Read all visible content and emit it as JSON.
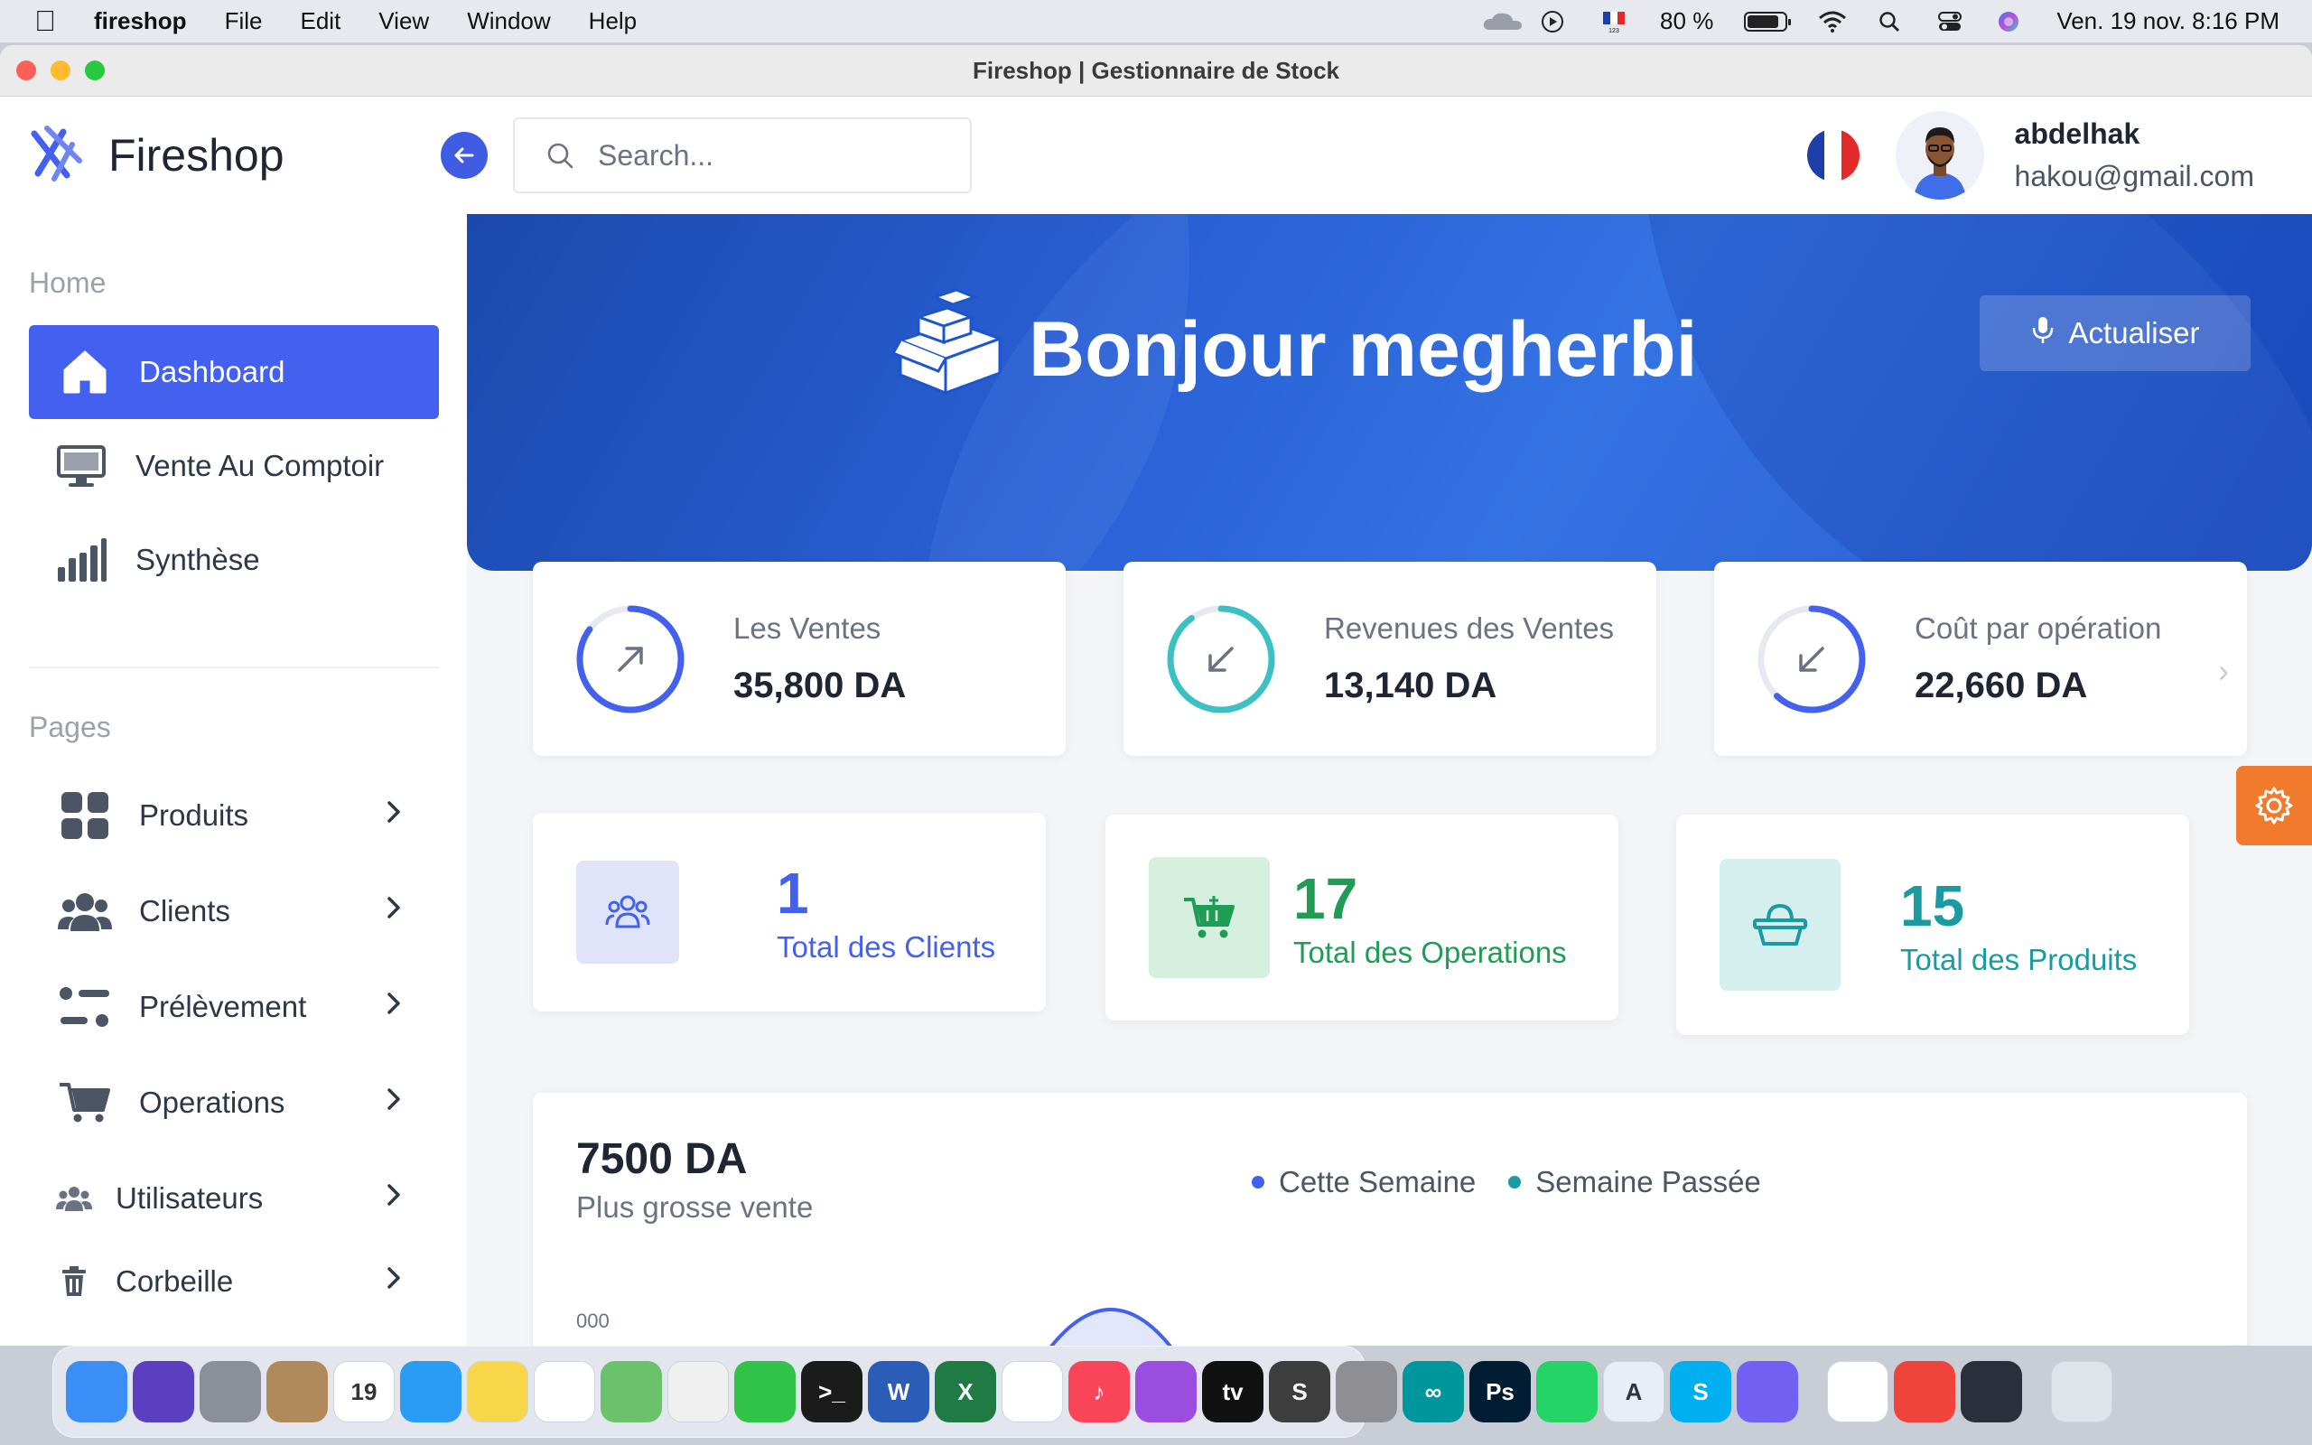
{
  "menubar": {
    "app_name": "fireshop",
    "menus": [
      "File",
      "Edit",
      "View",
      "Window",
      "Help"
    ],
    "battery": "80 %",
    "clock": "Ven. 19 nov.  8:16 PM"
  },
  "window": {
    "title": "Fireshop | Gestionnaire de Stock"
  },
  "header": {
    "brand": "Fireshop",
    "search_placeholder": "Search...",
    "user_name": "abdelhak",
    "user_email": "hakou@gmail.com"
  },
  "sidebar": {
    "home_label": "Home",
    "pages_label": "Pages",
    "items": [
      {
        "label": "Dashboard",
        "icon": "home-icon"
      },
      {
        "label": "Vente Au Comptoir",
        "icon": "monitor-icon"
      },
      {
        "label": "Synthèse",
        "icon": "bar-chart-icon"
      },
      {
        "label": "Produits",
        "icon": "grid-icon"
      },
      {
        "label": "Clients",
        "icon": "users-icon"
      },
      {
        "label": "Prélèvement",
        "icon": "list-toggle-icon"
      },
      {
        "label": "Operations",
        "icon": "cart-icon"
      },
      {
        "label": "Utilisateurs",
        "icon": "user-group-icon"
      },
      {
        "label": "Corbeille",
        "icon": "trash-icon"
      }
    ]
  },
  "hero": {
    "greeting": "Bonjour megherbi",
    "refresh_label": "Actualiser"
  },
  "stats": [
    {
      "label": "Les Ventes",
      "value": "35,800 DA",
      "icon": "arrow-up-right-icon",
      "color": "#4361ee",
      "progress": 0.85
    },
    {
      "label": "Revenues des Ventes",
      "value": "13,140 DA",
      "icon": "arrow-down-left-icon",
      "color": "#3bc0c3",
      "progress": 0.9
    },
    {
      "label": "Coût par opération",
      "value": "22,660 DA",
      "icon": "arrow-down-left-icon",
      "color": "#4361ee",
      "progress": 0.62
    }
  ],
  "counts": [
    {
      "number": "1",
      "label": "Total des Clients",
      "color": "#4361ee",
      "bg": "#dfe4fb",
      "icon": "users-icon"
    },
    {
      "number": "17",
      "label": "Total des Operations",
      "color": "#1f9d55",
      "bg": "#d6f0e0",
      "icon": "cart-icon"
    },
    {
      "number": "15",
      "label": "Total des Produits",
      "color": "#1a9ba1",
      "bg": "#d5eeee",
      "icon": "basket-icon"
    }
  ],
  "chart_data": {
    "type": "area",
    "title": "7500 DA",
    "subtitle": "Plus grosse vente",
    "series": [
      {
        "name": "Cette Semaine",
        "color": "#4361ee"
      },
      {
        "name": "Semaine Passée",
        "color": "#1a9ba1"
      }
    ],
    "tick_label_partial": "000"
  },
  "colors": {
    "accent": "#4361ee",
    "settings": "#f27a2c"
  },
  "dock": {
    "apps": [
      {
        "name": "Finder",
        "color": "#3b8ef5",
        "glyph": ""
      },
      {
        "name": "Siri",
        "color": "#5a3fc0",
        "glyph": ""
      },
      {
        "name": "Launchpad",
        "color": "#8a8f9a",
        "glyph": ""
      },
      {
        "name": "Contacts",
        "color": "#b08a5a",
        "glyph": ""
      },
      {
        "name": "Calendar",
        "color": "#ffffff",
        "glyph": "19"
      },
      {
        "name": "Safari",
        "color": "#2a9cf4",
        "glyph": ""
      },
      {
        "name": "Notes",
        "color": "#f7d64a",
        "glyph": ""
      },
      {
        "name": "Chrome",
        "color": "#ffffff",
        "glyph": ""
      },
      {
        "name": "Maps",
        "color": "#6cc26b",
        "glyph": ""
      },
      {
        "name": "Photos",
        "color": "#f0f0f0",
        "glyph": ""
      },
      {
        "name": "FaceTime",
        "color": "#31c24a",
        "glyph": ""
      },
      {
        "name": "Terminal",
        "color": "#1b1b1b",
        "glyph": ">_"
      },
      {
        "name": "Word",
        "color": "#2b5cb8",
        "glyph": "W"
      },
      {
        "name": "Excel",
        "color": "#1f7a43",
        "glyph": "X"
      },
      {
        "name": "VS Code",
        "color": "#ffffff",
        "glyph": ""
      },
      {
        "name": "Music",
        "color": "#f9445a",
        "glyph": "♪"
      },
      {
        "name": "Podcasts",
        "color": "#9b4de0",
        "glyph": ""
      },
      {
        "name": "TV",
        "color": "#111111",
        "glyph": "tv"
      },
      {
        "name": "Sublime",
        "color": "#3d3d3d",
        "glyph": "S"
      },
      {
        "name": "Preferences",
        "color": "#8e8e93",
        "glyph": ""
      },
      {
        "name": "Arduino",
        "color": "#00979c",
        "glyph": "∞"
      },
      {
        "name": "Photoshop",
        "color": "#001d34",
        "glyph": "Ps"
      },
      {
        "name": "WhatsApp",
        "color": "#25d366",
        "glyph": ""
      },
      {
        "name": "App Store",
        "color": "#e8eef8",
        "glyph": "A"
      },
      {
        "name": "Skype",
        "color": "#00aff0",
        "glyph": "S"
      },
      {
        "name": "Viber",
        "color": "#7360f2",
        "glyph": ""
      },
      {
        "name": "VS Code 2",
        "color": "#ffffff",
        "glyph": ""
      },
      {
        "name": "AnyDesk",
        "color": "#ef443b",
        "glyph": ""
      },
      {
        "name": "Electron",
        "color": "#2b2e3b",
        "glyph": ""
      },
      {
        "name": "Trash",
        "color": "#dfe3ea",
        "glyph": ""
      }
    ]
  }
}
